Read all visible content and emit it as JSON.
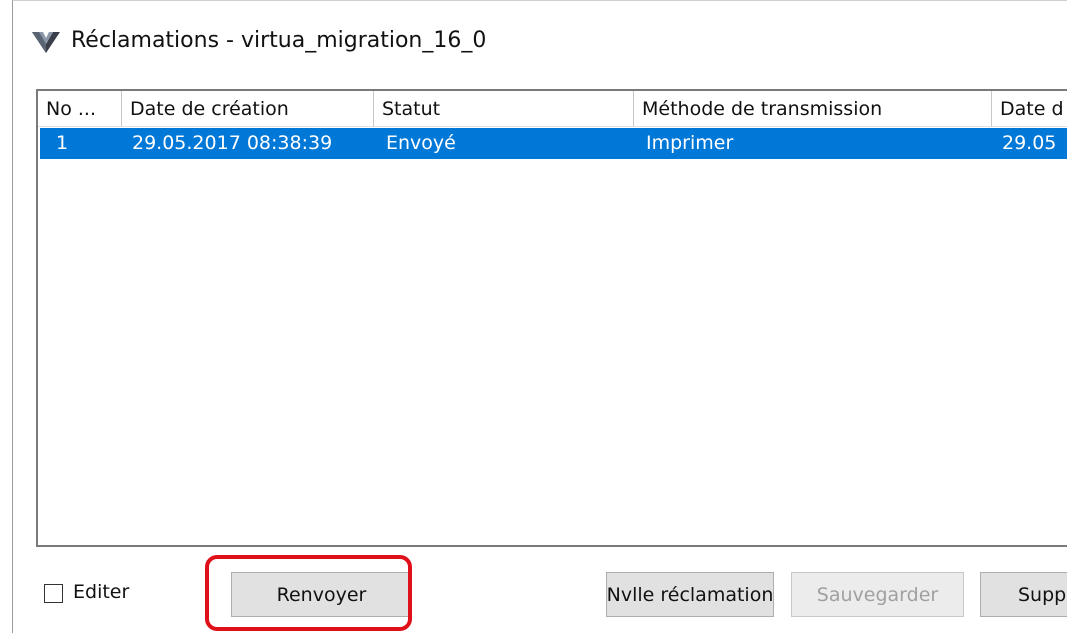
{
  "window": {
    "title": "Réclamations - virtua_migration_16_0"
  },
  "table": {
    "columns": [
      "No ...",
      "Date de création",
      "Statut",
      "Méthode de transmission",
      "Date d"
    ],
    "rows": [
      [
        "1",
        "29.05.2017 08:38:39",
        "Envoyé",
        "Imprimer",
        "29.05"
      ]
    ]
  },
  "footer": {
    "checkbox_label": "Editer",
    "resend_label": "Renvoyer",
    "new_label": "Nvlle réclamation",
    "save_label": "Sauvegarder",
    "delete_label": "Suppr"
  },
  "colors": {
    "selection": "#0078d7",
    "highlight": "#e0101a"
  },
  "icons": {
    "app": "virtua-app-icon"
  }
}
